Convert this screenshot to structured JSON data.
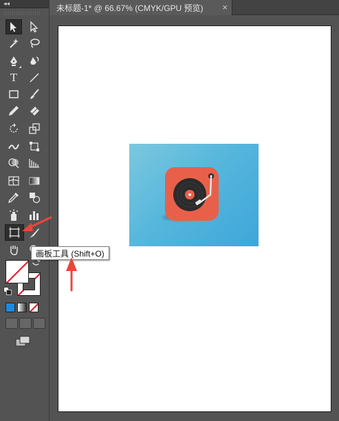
{
  "document_tab": {
    "title": "未标题-1* @ 66.67% (CMYK/GPU 预览)",
    "close": "×"
  },
  "toolbar": {
    "collapse": "◂◂",
    "tools": [
      "selection-icon",
      "direct-selection-icon",
      "magic-wand-icon",
      "lasso-icon",
      "pen-icon",
      "curvature-pen-icon",
      "type-icon",
      "line-segment-icon",
      "rectangle-icon",
      "paintbrush-icon",
      "pencil-icon",
      "eraser-icon",
      "rotate-icon",
      "scale-icon",
      "width-icon",
      "free-transform-icon",
      "shape-builder-icon",
      "perspective-grid-icon",
      "mesh-icon",
      "gradient-icon",
      "eyedropper-icon",
      "blend-icon",
      "symbol-sprayer-icon",
      "column-graph-icon",
      "artboard-icon",
      "slice-icon",
      "hand-icon",
      "zoom-icon"
    ],
    "type_glyph": "T"
  },
  "tooltip": {
    "text": "画板工具 (Shift+O)"
  },
  "colors": {
    "annotation_arrow": "#f0443a",
    "tile": "#e8604a",
    "background_top": "#7cc8df",
    "background_bottom": "#3ea6da",
    "record": "#2b2b2b",
    "label": "#e8604a"
  }
}
